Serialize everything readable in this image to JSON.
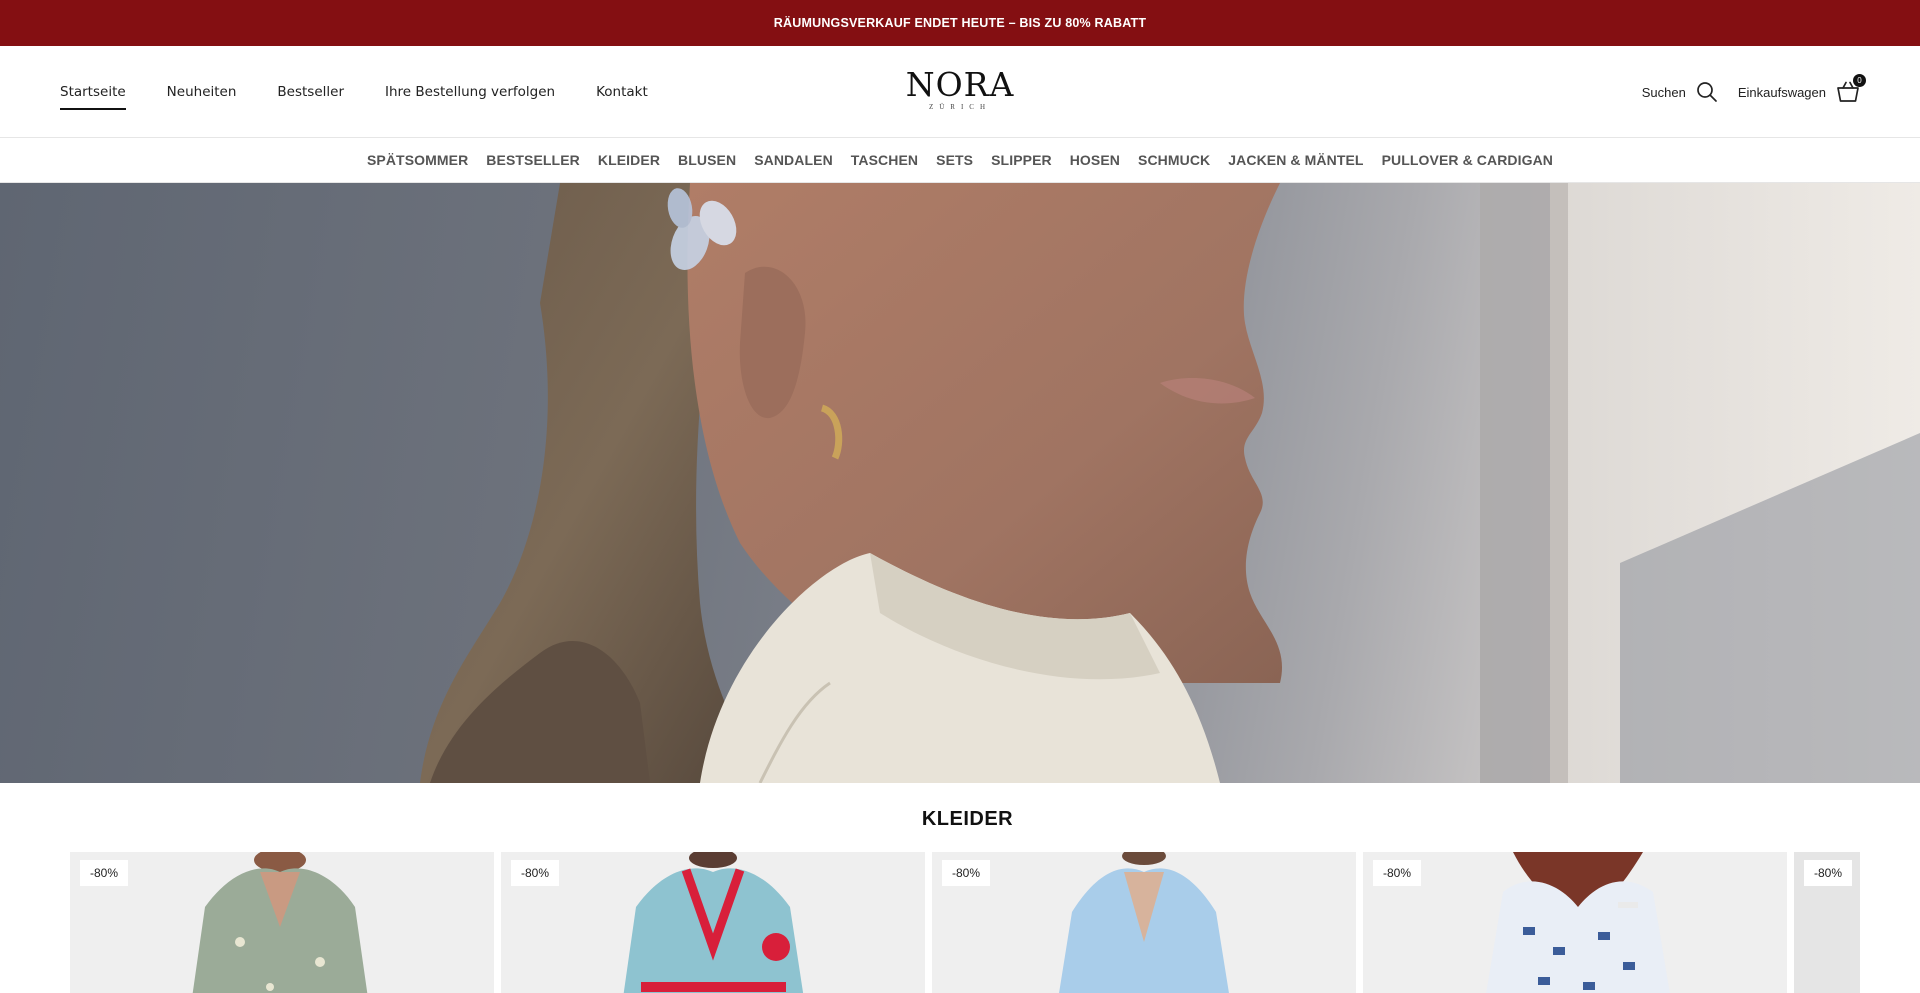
{
  "announcement": "RÄUMUNGSVERKAUF ENDET HEUTE – BIS ZU 80% RABATT",
  "nav": [
    {
      "label": "Startseite",
      "active": true
    },
    {
      "label": "Neuheiten"
    },
    {
      "label": "Bestseller"
    },
    {
      "label": "Ihre Bestellung verfolgen"
    },
    {
      "label": "Kontakt"
    }
  ],
  "logo": {
    "word": "NORA",
    "sub": "ZÜRICH"
  },
  "tools": {
    "search_label": "Suchen",
    "cart_label": "Einkaufswagen",
    "cart_count": "0"
  },
  "categories": [
    "SPÄTSOMMER",
    "BESTSELLER",
    "KLEIDER",
    "BLUSEN",
    "SANDALEN",
    "TASCHEN",
    "SETS",
    "SLIPPER",
    "HOSEN",
    "SCHMUCK",
    "JACKEN & MÄNTEL",
    "PULLOVER & CARDIGAN"
  ],
  "section": {
    "title": "KLEIDER"
  },
  "products": [
    {
      "badge": "-80%",
      "dress_color": "#9bab98"
    },
    {
      "badge": "-80%",
      "dress_color": "#8ec3d0"
    },
    {
      "badge": "-80%",
      "dress_color": "#a9cdea"
    },
    {
      "badge": "-80%",
      "dress_color": "#e9eef6"
    },
    {
      "badge": "-80%",
      "dress_color": "#dcdcdc"
    }
  ],
  "colors": {
    "announce_bg": "#840f12",
    "text": "#111111",
    "muted_category": "#555555"
  }
}
